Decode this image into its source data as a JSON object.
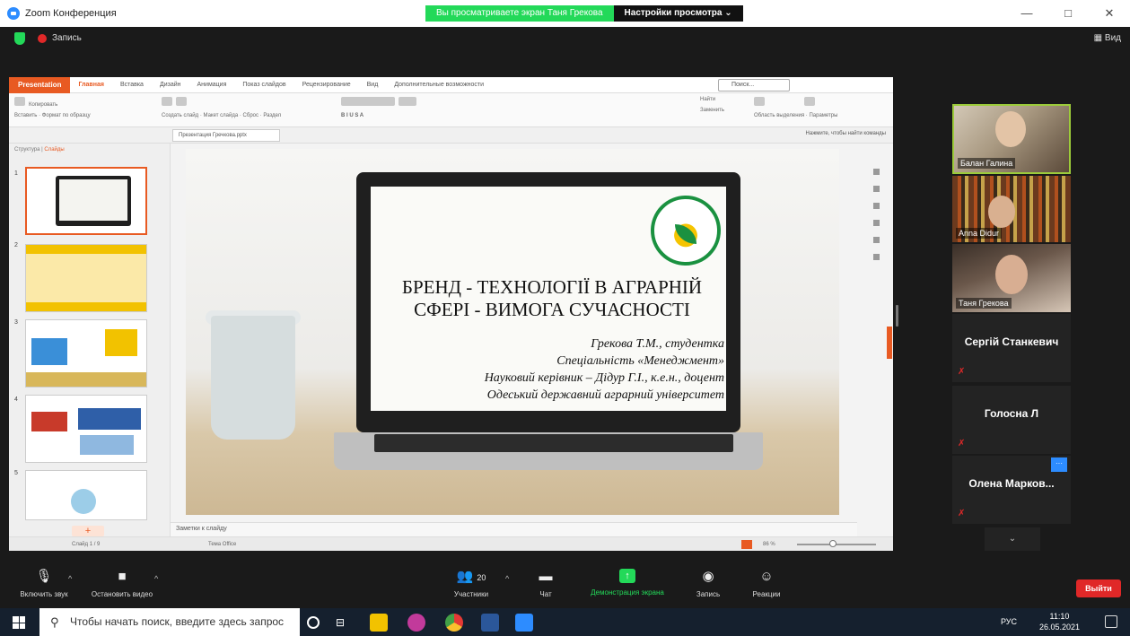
{
  "window": {
    "app_title": "Zoom Конференция",
    "viewing_banner": "Вы просматриваете экран Таня Грекова",
    "view_options": "Настройки просмотра ⌄",
    "minimize": "—",
    "maximize": "□",
    "close": "✕"
  },
  "meeting": {
    "recording_label": "Запись",
    "view_label": "Вид"
  },
  "presentation_app": {
    "brand": "Presentation",
    "tabs": [
      "Главная",
      "Вставка",
      "Дизайн",
      "Анимация",
      "Показ слайдов",
      "Рецензирование",
      "Вид",
      "Дополнительные возможности"
    ],
    "search_placeholder": "Поиск...",
    "ribbon_labels": [
      "Вставить",
      "Копировать",
      "Формат по образцу",
      "Создать слайд",
      "Макет слайда",
      "Сброс",
      "Раздел",
      "Найти",
      "Заменить",
      "Область выделения",
      "Параметры"
    ],
    "doc_tab": "Презентация Гречкова.pptx",
    "find_command": "Нажмите, чтобы найти команды",
    "panel_tabs": [
      "Структура",
      "Слайды"
    ],
    "notes_placeholder": "Заметки к слайду",
    "status_slide": "Слайд 1 / 9",
    "status_theme": "Тема Office",
    "zoom_percent": "86 %"
  },
  "slide": {
    "title_line1": "БРЕНД - ТЕХНОЛОГІЇ В АГРАРНІЙ",
    "title_line2": "СФЕРІ - ВИМОГА СУЧАСНОСТІ",
    "author": "Грекова Т.М., студентка",
    "specialty": "Спеціальність «Менеджмент»",
    "supervisor": "Науковий керівник – Дідур Г.І., к.е.н., доцент",
    "university": "Одеський державний аграрний університет"
  },
  "thumbnails": [
    "1",
    "2",
    "3",
    "4",
    "5"
  ],
  "participants": [
    {
      "name": "Балан Галина"
    },
    {
      "name": "Anna Didur"
    },
    {
      "name": "Таня Грекова"
    },
    {
      "name": "Сергій Станкевич"
    },
    {
      "name": "Голосна Л"
    },
    {
      "name": "Олена Марков..."
    }
  ],
  "toolbar": {
    "mute_label": "Включить звук",
    "video_label": "Остановить видео",
    "participants_count": "20",
    "participants_label": "Участники",
    "chat_label": "Чат",
    "share_label": "Демонстрация экрана",
    "record_label": "Запись",
    "reactions_label": "Реакции",
    "leave_label": "Выйти"
  },
  "taskbar": {
    "search_placeholder": "Чтобы начать поиск, введите здесь запрос",
    "lang": "РУС",
    "time": "11:10",
    "date": "26.05.2021"
  },
  "colors": {
    "zoom_green": "#23d959",
    "zoom_red": "#e02828",
    "wps_orange": "#e85a22",
    "active_speaker": "#9ccb3a"
  }
}
